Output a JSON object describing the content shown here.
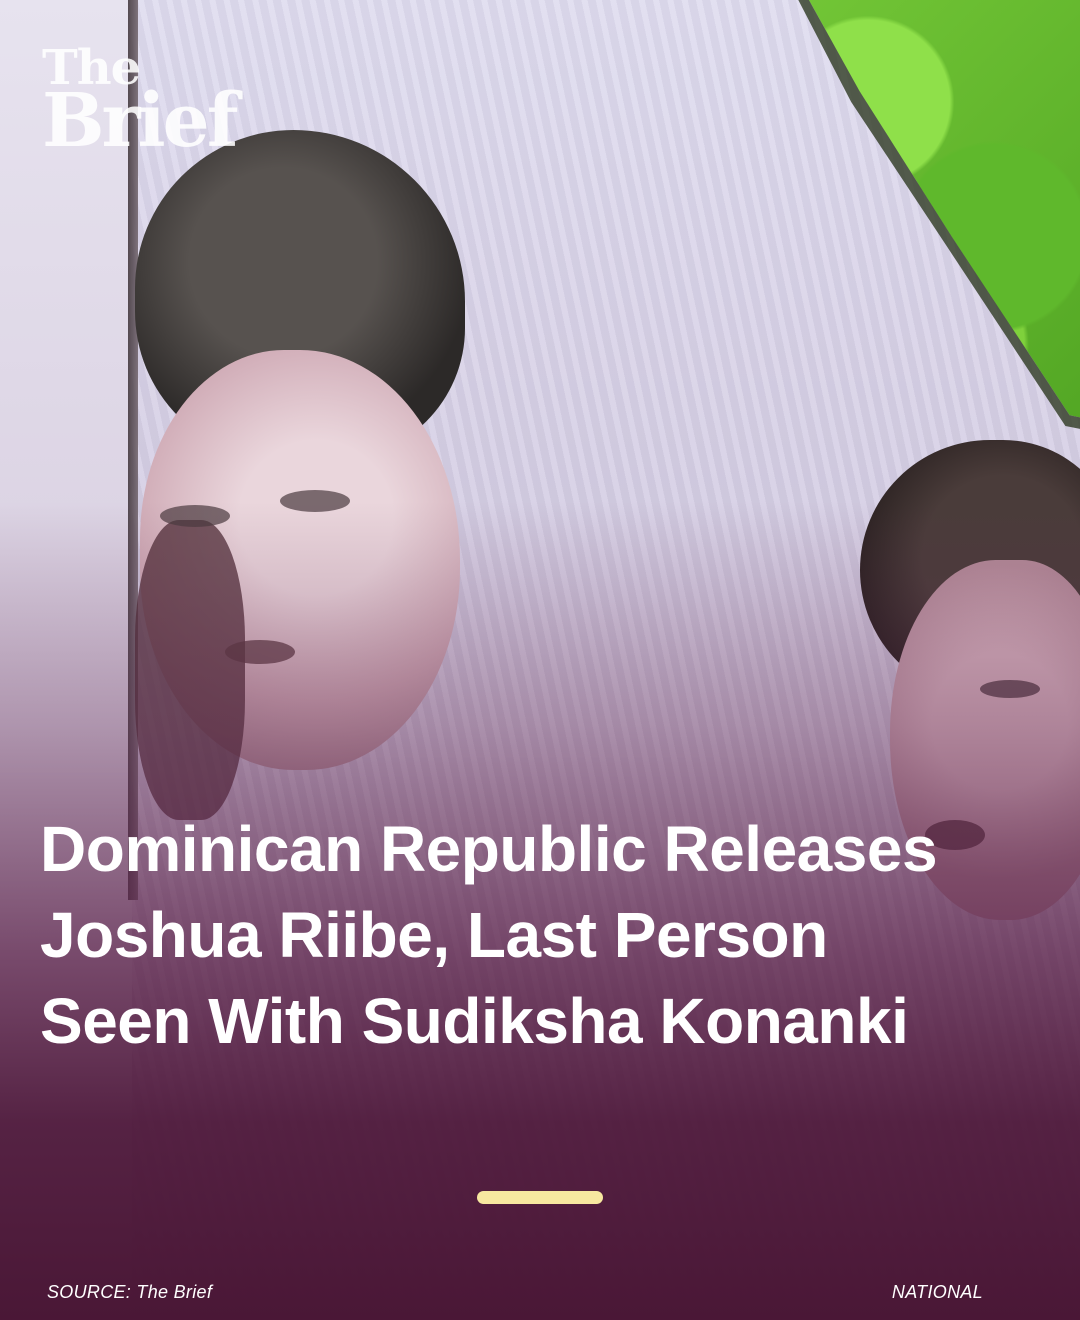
{
  "logo": {
    "line1": "The",
    "line2": "Brief"
  },
  "headline": "Dominican Republic Releases Joshua Riibe, Last Person Seen With Sudiksha Konanki",
  "footer": {
    "source": "SOURCE: The Brief",
    "category": "NATIONAL"
  },
  "colors": {
    "background": "#4a1736",
    "accent_bar": "#f7e8a0",
    "text": "#ffffff"
  }
}
